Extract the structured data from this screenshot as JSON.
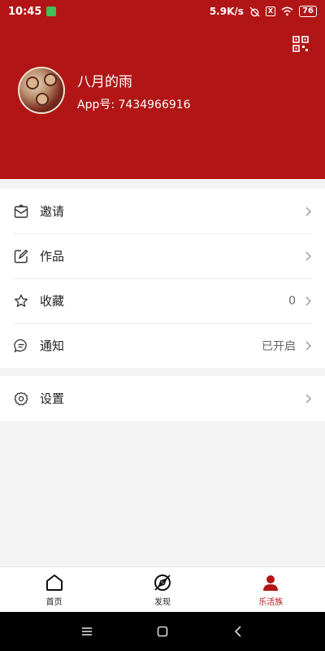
{
  "status_bar": {
    "time": "10:45",
    "network_speed": "5.9K/s",
    "battery": "76"
  },
  "profile": {
    "name": "八月的雨",
    "app_id": "App号: 7434966916"
  },
  "menu": {
    "invite": {
      "label": "邀请",
      "icon": "envelope-icon"
    },
    "works": {
      "label": "作品",
      "icon": "edit-icon"
    },
    "favorites": {
      "label": "收藏",
      "value": "0",
      "icon": "star-icon"
    },
    "notifications": {
      "label": "通知",
      "value": "已开启",
      "icon": "chat-bubble-icon"
    },
    "settings": {
      "label": "设置",
      "icon": "gear-icon"
    }
  },
  "tabs": [
    {
      "label": "首页",
      "icon": "home-icon"
    },
    {
      "label": "发现",
      "icon": "discover-icon"
    },
    {
      "label": "乐活族",
      "icon": "user-icon",
      "active": true
    }
  ],
  "colors": {
    "brand": "#b21515",
    "background": "#f4f4f4"
  }
}
